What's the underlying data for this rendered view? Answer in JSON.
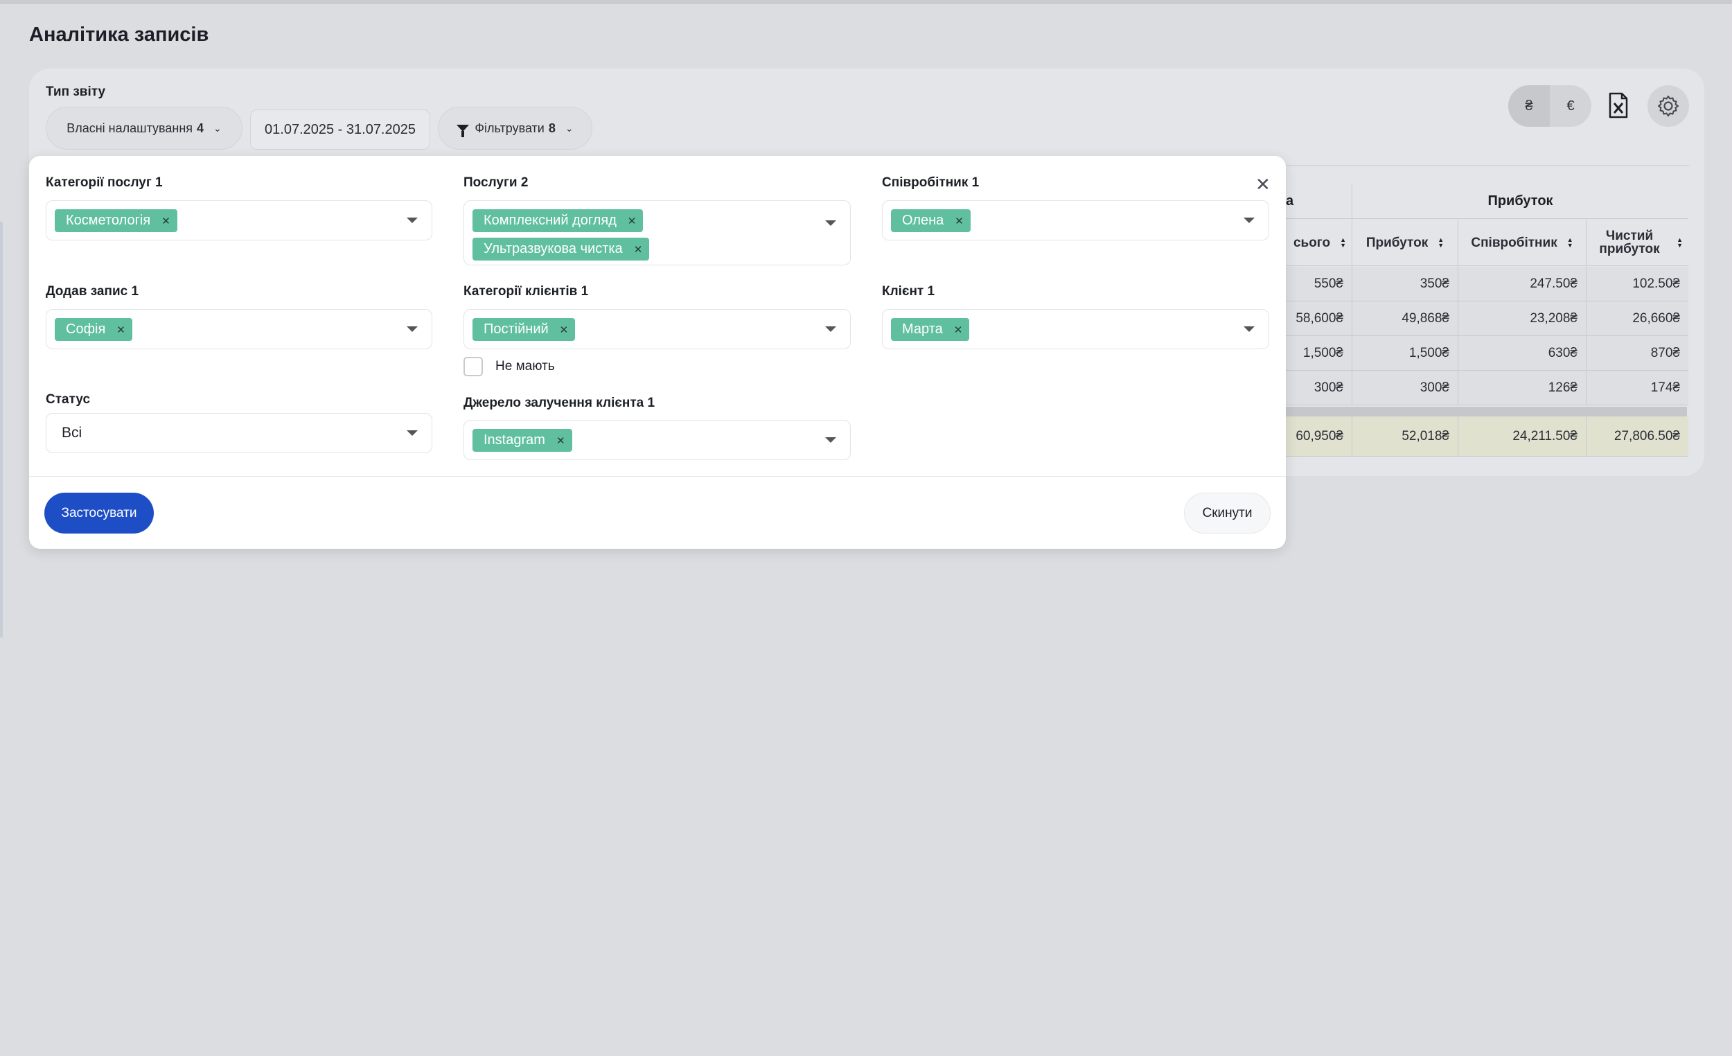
{
  "page": {
    "title": "Аналітика записів"
  },
  "toolbar": {
    "report_type_label": "Тип звіту",
    "settings_label": "Власні налаштування",
    "settings_count": "4",
    "date_range": "01.07.2025 - 31.07.2025",
    "filter_label": "Фільтрувати",
    "filter_count": "8",
    "currency_options": [
      "₴",
      "€"
    ],
    "currency_selected": "₴"
  },
  "table": {
    "group_headers": [
      "а",
      "Прибуток"
    ],
    "columns": [
      "сього",
      "Прибуток",
      "Співробітник",
      "Чистий прибуток"
    ],
    "rows": [
      [
        "550₴",
        "350₴",
        "247.50₴",
        "102.50₴"
      ],
      [
        "58,600₴",
        "49,868₴",
        "23,208₴",
        "26,660₴"
      ],
      [
        "1,500₴",
        "1,500₴",
        "630₴",
        "870₴"
      ],
      [
        "300₴",
        "300₴",
        "126₴",
        "174₴"
      ]
    ],
    "totals": [
      "60,950₴",
      "52,018₴",
      "24,211.50₴",
      "27,806.50₴"
    ]
  },
  "filters": {
    "service_categories": {
      "label": "Категорії послуг 1",
      "tags": [
        "Косметологія"
      ]
    },
    "services": {
      "label": "Послуги 2",
      "tags": [
        "Комплексний догляд",
        "Ультразвукова чистка"
      ]
    },
    "employee": {
      "label": "Співробітник 1",
      "tags": [
        "Олена"
      ]
    },
    "added_by": {
      "label": "Додав запис 1",
      "tags": [
        "Софія"
      ]
    },
    "client_categories": {
      "label": "Категорії клієнтів 1",
      "tags": [
        "Постійний"
      ]
    },
    "client": {
      "label": "Клієнт 1",
      "tags": [
        "Марта"
      ]
    },
    "no_category": {
      "label": "Не мають",
      "checked": false
    },
    "status": {
      "label": "Статус",
      "value": "Всі"
    },
    "acquisition_source": {
      "label": "Джерело залучення клієнта 1",
      "tags": [
        "Instagram"
      ]
    }
  },
  "actions": {
    "apply": "Застосувати",
    "reset": "Скинути"
  },
  "colors": {
    "tag": "#5fbf9f",
    "primary": "#1e4ec6",
    "background": "#dcdde1"
  }
}
